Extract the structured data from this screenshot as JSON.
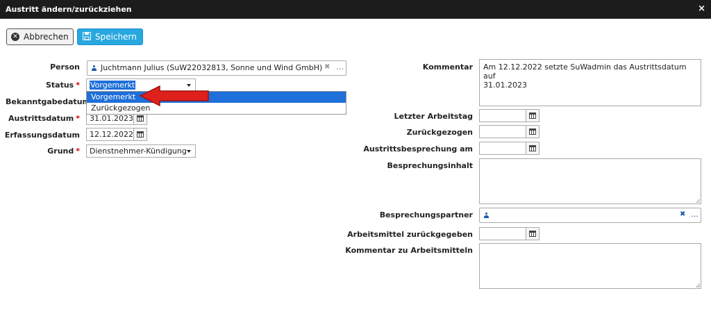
{
  "dialog": {
    "title": "Austritt ändern/zurückziehen",
    "close": "×"
  },
  "toolbar": {
    "cancel_label": "Abbrechen",
    "save_label": "Speichern"
  },
  "left": {
    "person_label": "Person",
    "person_value": "Juchtmann Julius (SuW22032813, Sonne und Wind GmbH)",
    "status_label": "Status",
    "status_value": "Vorgemerkt",
    "status_options": [
      "Vorgemerkt",
      "Zurückgezogen"
    ],
    "bekanntgabe_label": "Bekanntgabedatum",
    "austritt_label": "Austrittsdatum",
    "austritt_value": "31.01.2023",
    "erfassung_label": "Erfassungsdatum",
    "erfassung_value": "12.12.2022",
    "grund_label": "Grund",
    "grund_value": "Dienstnehmer-Kündigung",
    "required_marker": "*"
  },
  "right": {
    "kommentar_label": "Kommentar",
    "kommentar_value": "Am 12.12.2022 setzte SuWadmin das Austrittsdatum auf\n31.01.2023",
    "letzter_label": "Letzter Arbeitstag",
    "zurueck_label": "Zurückgezogen",
    "besprechung_label": "Austrittsbesprechung am",
    "inhalt_label": "Besprechungsinhalt",
    "partner_label": "Besprechungspartner",
    "arbeitsmittel_label": "Arbeitsmittel zurückgegeben",
    "kommentar_am_label": "Kommentar zu Arbeitsmitteln"
  },
  "colors": {
    "primary": "#29a8e0",
    "selected": "#1e6fd9",
    "required": "#cc0000",
    "arrow": "#e0201b"
  }
}
